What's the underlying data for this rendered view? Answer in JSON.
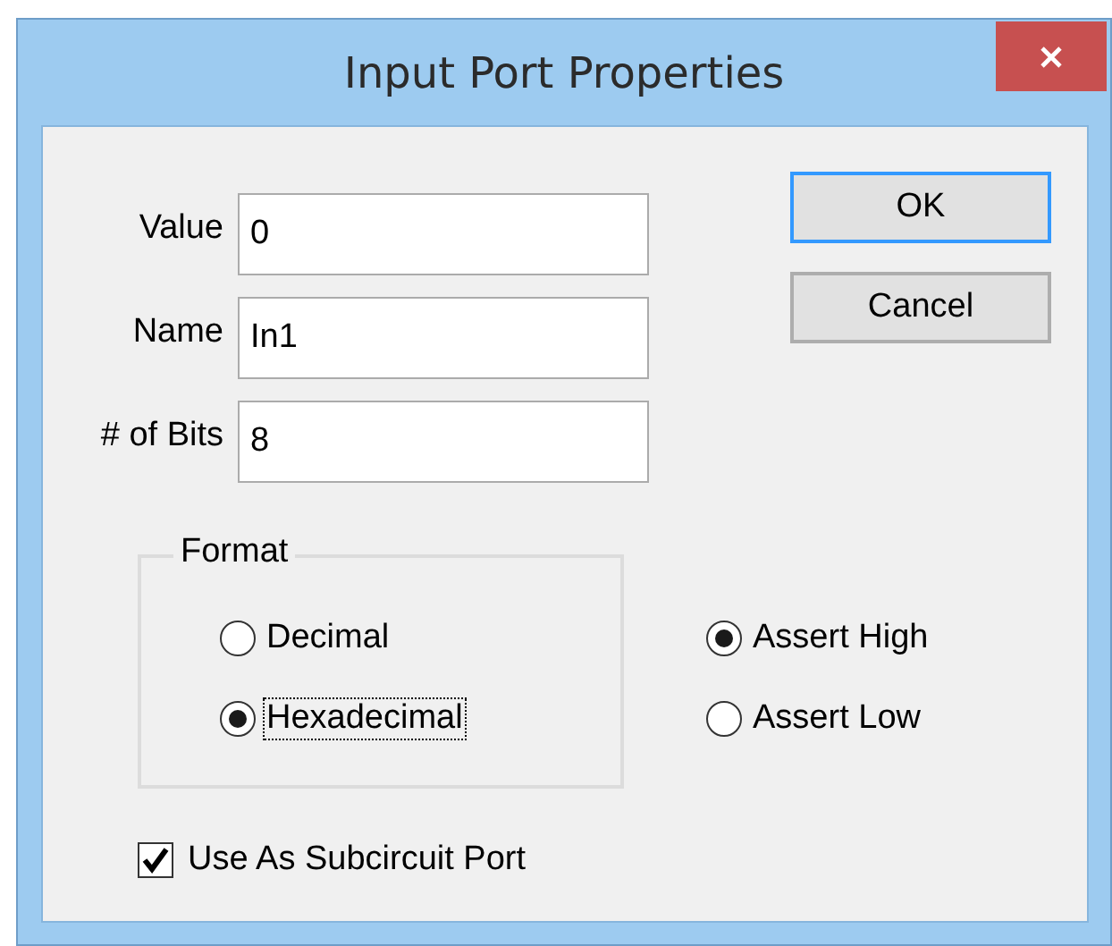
{
  "window": {
    "title": "Input Port Properties"
  },
  "fields": [
    {
      "label": "Value",
      "value": "0"
    },
    {
      "label": "Name",
      "value": "In1"
    },
    {
      "label": "# of Bits",
      "value": "8"
    }
  ],
  "buttons": [
    {
      "label": "OK",
      "focused": true
    },
    {
      "label": "Cancel",
      "focused": false
    }
  ],
  "format": {
    "title": "Format",
    "options": [
      {
        "label": "Decimal",
        "selected": false,
        "focused": false
      },
      {
        "label": "Hexadecimal",
        "selected": true,
        "focused": true
      }
    ]
  },
  "assert": [
    {
      "label": "Assert High",
      "selected": true
    },
    {
      "label": "Assert Low",
      "selected": false
    }
  ],
  "subcircuit": {
    "label": "Use As Subcircuit Port",
    "checked": true
  }
}
